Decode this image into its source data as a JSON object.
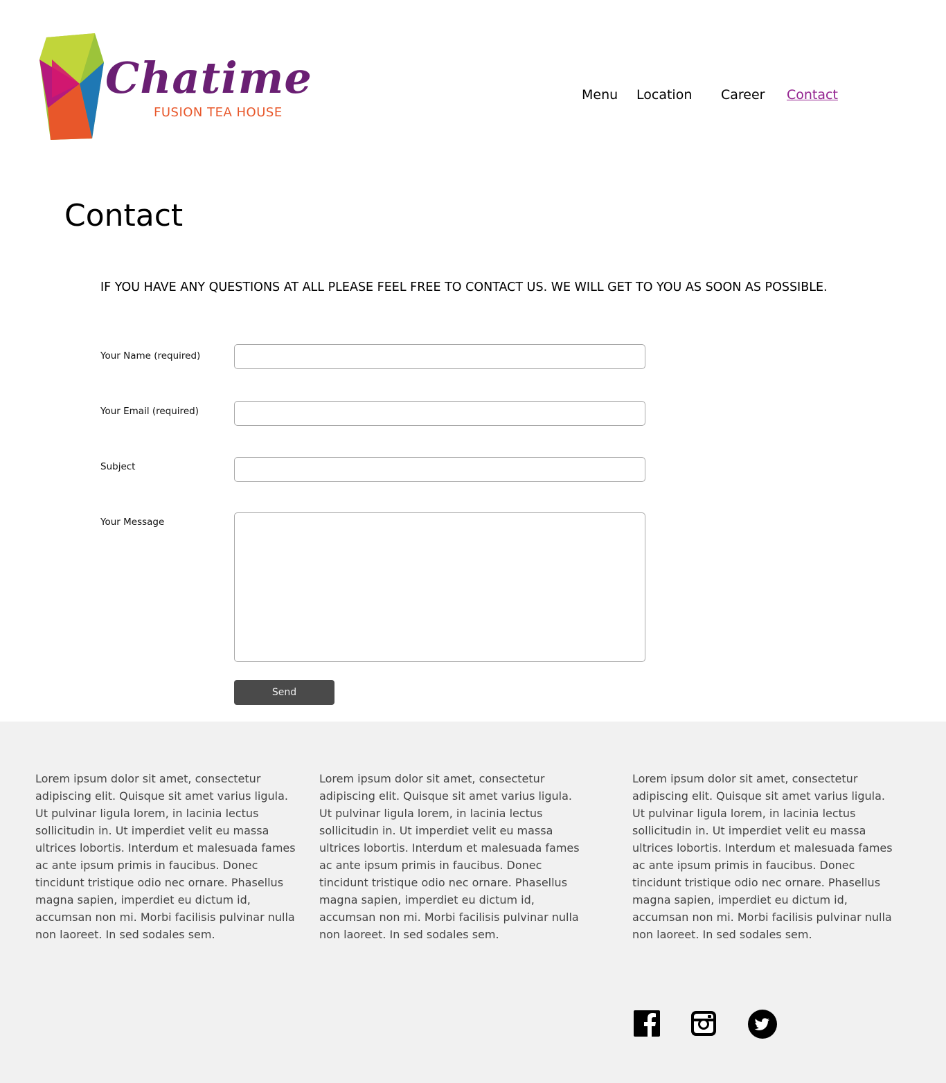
{
  "brand": {
    "wordmark": "Chatime",
    "tagline": "FUSION TEA HOUSE",
    "colors": {
      "purple": "#6a1f73",
      "orange": "#e8572a",
      "magenta": "#b5197d",
      "green": "#9cc43a",
      "blue": "#1f78b4"
    }
  },
  "nav": {
    "items": [
      {
        "label": "Menu"
      },
      {
        "label": "Location"
      },
      {
        "label": "Career"
      },
      {
        "label": "Contact",
        "active": true
      }
    ],
    "active_color": "#93228f"
  },
  "page": {
    "title": "Contact",
    "intro": "IF YOU HAVE ANY QUESTIONS AT ALL PLEASE FEEL FREE TO CONTACT US. WE WILL GET TO YOU AS SOON AS POSSIBLE."
  },
  "form": {
    "name_label": "Your Name (required)",
    "email_label": "Your Email (required)",
    "subject_label": "Subject",
    "message_label": "Your Message",
    "name_value": "",
    "email_value": "",
    "subject_value": "",
    "message_value": "",
    "send_label": "Send"
  },
  "footer": {
    "columns": [
      {
        "text": "Lorem ipsum dolor sit amet, consectetur adipiscing elit. Quisque sit amet varius ligula. Ut pulvinar ligula lorem, in lacinia lectus sollicitudin in. Ut imperdiet velit eu massa ultrices lobortis. Interdum et malesuada fames ac ante ipsum primis in faucibus. Donec tincidunt tristique odio nec ornare. Phasellus magna sapien, imperdiet eu dictum id, accumsan non mi. Morbi facilisis pulvinar nulla non laoreet. In sed sodales sem."
      },
      {
        "text": "Lorem ipsum dolor sit amet, consectetur adipiscing elit. Quisque sit amet varius ligula. Ut pulvinar ligula lorem, in lacinia lectus sollicitudin in. Ut imperdiet velit eu massa ultrices lobortis. Interdum et malesuada fames ac ante ipsum primis in faucibus. Donec tincidunt tristique odio nec ornare. Phasellus magna sapien, imperdiet eu dictum id, accumsan non mi. Morbi facilisis pulvinar nulla non laoreet. In sed sodales sem."
      },
      {
        "text": "Lorem ipsum dolor sit amet, consectetur adipiscing elit. Quisque sit amet varius ligula. Ut pulvinar ligula lorem, in lacinia lectus sollicitudin in. Ut imperdiet velit eu massa ultrices lobortis. Interdum et malesuada fames ac ante ipsum primis in faucibus. Donec tincidunt tristique odio nec ornare. Phasellus magna sapien, imperdiet eu dictum id, accumsan non mi. Morbi facilisis pulvinar nulla non laoreet. In sed sodales sem."
      }
    ],
    "social_icons": [
      "facebook-icon",
      "instagram-icon",
      "twitter-icon"
    ],
    "background": "#f1f1f1"
  }
}
